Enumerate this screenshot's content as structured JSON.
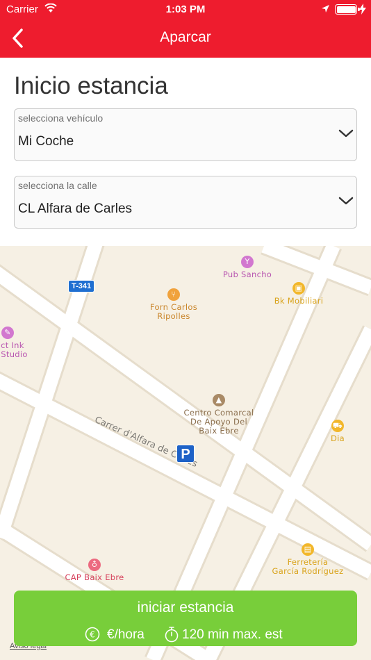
{
  "status_bar": {
    "carrier": "Carrier",
    "time": "1:03 PM"
  },
  "nav": {
    "title": "Aparcar"
  },
  "page": {
    "heading": "Inicio estancia"
  },
  "vehicle_select": {
    "label": "selecciona vehículo",
    "value": "Mi Coche"
  },
  "street_select": {
    "label": "selecciona la calle",
    "value": "CL Alfara de Carles"
  },
  "map": {
    "road_shield": "T-341",
    "street_name": "Carrer d'Alfara de Carles",
    "parking_marker": "P",
    "legal_link": "Aviso legal",
    "pois": [
      {
        "name": "Pub Sancho",
        "lines": [
          "Pub Sancho"
        ],
        "icon": "cocktail-icon",
        "color": "pink"
      },
      {
        "name": "Forn Carlos Ripolles",
        "lines": [
          "Forn Carlos",
          "Ripolles"
        ],
        "icon": "restaurant-icon",
        "color": "orange"
      },
      {
        "name": "Bk Mobiliari",
        "lines": [
          "Bk Mobiliari"
        ],
        "icon": "shop-icon",
        "color": "gold"
      },
      {
        "name": "dict Ink o Studio",
        "lines": [
          "dict Ink",
          "o Studio"
        ],
        "icon": "tattoo-icon",
        "color": "pink"
      },
      {
        "name": "Centro Comarcal De Apoyo Del Baix Ebre",
        "lines": [
          "Centro Comarcal",
          "De Apoyo Del",
          "Baix Ebre"
        ],
        "icon": "school-icon",
        "color": "brown"
      },
      {
        "name": "Dia",
        "lines": [
          "Dia"
        ],
        "icon": "cart-icon",
        "color": "gold"
      },
      {
        "name": "CAP Baix Ebre",
        "lines": [
          "CAP Baix Ebre"
        ],
        "icon": "stethoscope-icon",
        "color": "red"
      },
      {
        "name": "Ferretería García Rodríguez",
        "lines": [
          "Ferretería",
          "García Rodríguez"
        ],
        "icon": "hardware-icon",
        "color": "gold"
      }
    ]
  },
  "cta": {
    "label": "iniciar estancia",
    "rate": "€/hora",
    "max_stay": "120 min max. est"
  },
  "colors": {
    "brand_red": "#ee1c2e",
    "cta_green": "#78ce3a"
  }
}
